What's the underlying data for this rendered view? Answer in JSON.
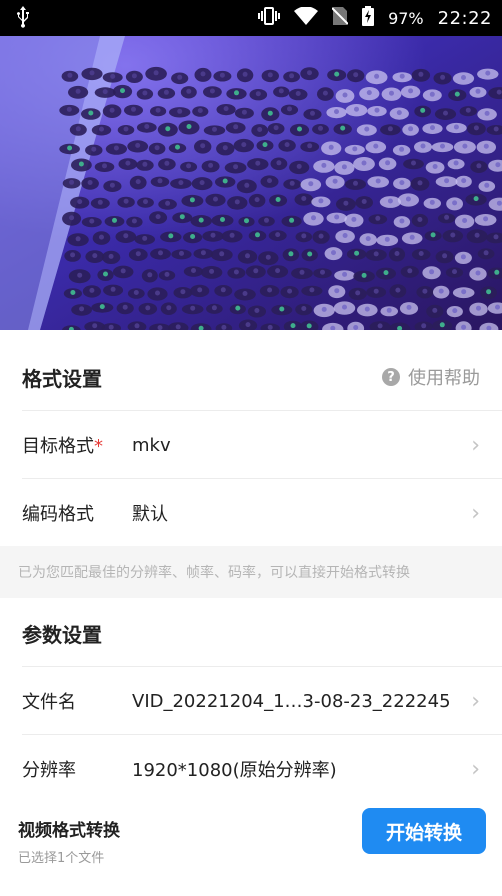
{
  "status_bar": {
    "battery": "97%",
    "time": "22:22"
  },
  "format_section": {
    "title": "格式设置",
    "help_label": "使用帮助",
    "target_label": "目标格式",
    "required_mark": "*",
    "target_value": "mkv",
    "codec_label": "编码格式",
    "codec_value": "默认",
    "hint": "已为您匹配最佳的分辨率、帧率、码率，可以直接开始格式转换"
  },
  "params_section": {
    "title": "参数设置",
    "filename_label": "文件名",
    "filename_value": "VID_20221204_1…3-08-23_222245",
    "resolution_label": "分辨率",
    "resolution_value": "1920*1080(原始分辨率)"
  },
  "bottom_bar": {
    "title": "视频格式转换",
    "subtitle": "已选择1个文件",
    "start_label": "开始转换"
  },
  "colors": {
    "accent": "#1f8bf2",
    "required": "#e53935"
  }
}
